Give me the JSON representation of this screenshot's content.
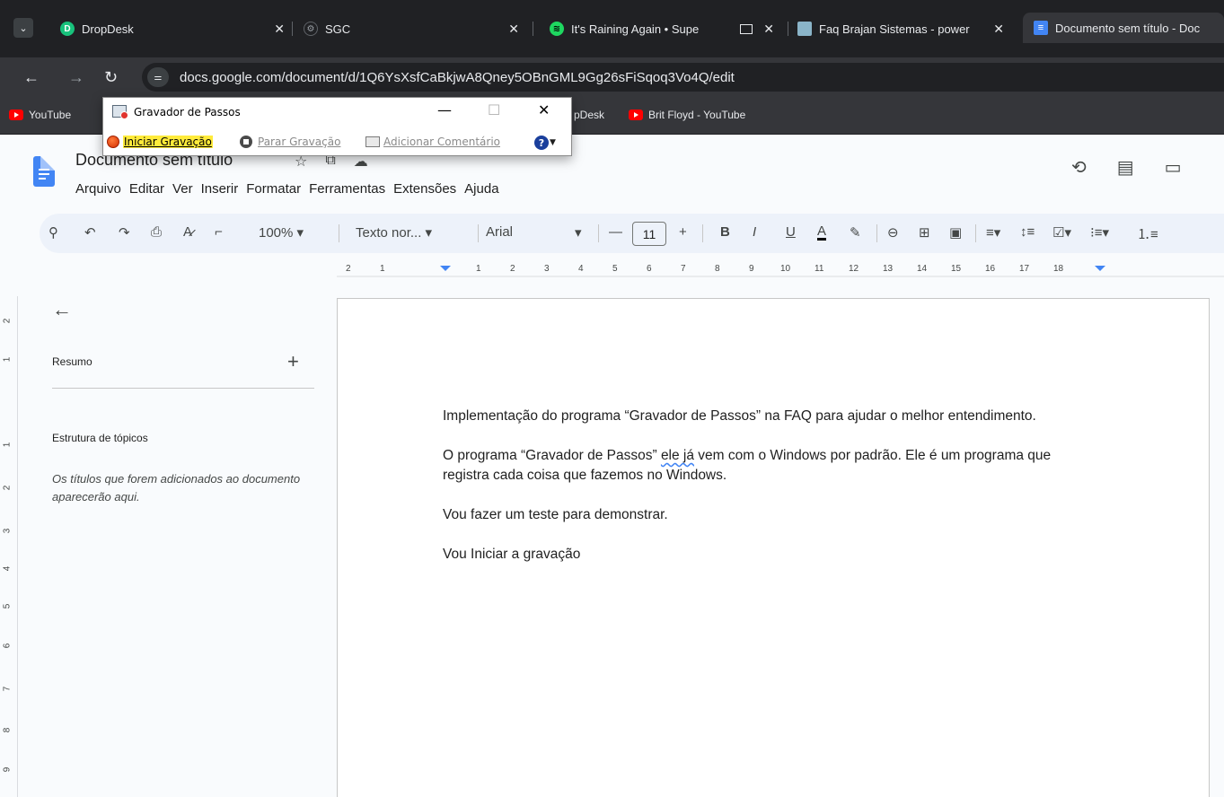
{
  "browser": {
    "tabs": [
      {
        "title": "DropDesk",
        "icon": "dropdesk-icon"
      },
      {
        "title": "SGC",
        "icon": "sgc-icon"
      },
      {
        "title": "It's Raining Again • Supe",
        "icon": "spotify-icon"
      },
      {
        "title": "Faq Brajan Sistemas - power",
        "icon": "faq-icon"
      },
      {
        "title": "Documento sem título - Doc",
        "icon": "google-docs-icon"
      }
    ],
    "url": "docs.google.com/document/d/1Q6YsXsfCaBkjwA8Qney5OBnGML9Gg26sFiSqoq3Vo4Q/edit",
    "bookmarks": [
      "YouTube",
      "pDesk",
      "Brit Floyd - YouTube"
    ]
  },
  "steps_recorder": {
    "title": "Gravador de Passos",
    "start": "Iniciar Gravação",
    "stop": "Parar Gravação",
    "comment": "Adicionar Comentário"
  },
  "docs": {
    "title": "Documento sem título",
    "menu": [
      "Arquivo",
      "Editar",
      "Ver",
      "Inserir",
      "Formatar",
      "Ferramentas",
      "Extensões",
      "Ajuda"
    ],
    "toolbar": {
      "zoom": "100%",
      "style": "Texto nor...",
      "font": "Arial",
      "font_size": "11"
    }
  },
  "outline": {
    "summary": "Resumo",
    "structure": "Estrutura de tópicos",
    "hint": "Os títulos que forem adicionados ao documento aparecerão aqui."
  },
  "document": {
    "p1": "Implementação do programa “Gravador de Passos” na FAQ para ajudar o melhor entendimento.",
    "p2_before": "O programa “Gravador de Passos” ",
    "p2_flag": "ele já",
    "p2_after": " vem com o Windows por padrão. Ele é um programa que registra cada coisa que fazemos no Windows.",
    "p3": "Vou fazer um teste para demonstrar.",
    "p4": "Vou Iniciar a gravação"
  },
  "ruler": {
    "labels": [
      "2",
      "1",
      "1",
      "2",
      "3",
      "4",
      "5",
      "6",
      "7",
      "8",
      "9",
      "10",
      "11",
      "12",
      "13",
      "14",
      "15",
      "16",
      "17",
      "18"
    ]
  },
  "vruler": {
    "labels": [
      "2",
      "1",
      "1",
      "2",
      "3",
      "4",
      "5",
      "6",
      "7",
      "8",
      "9"
    ]
  }
}
